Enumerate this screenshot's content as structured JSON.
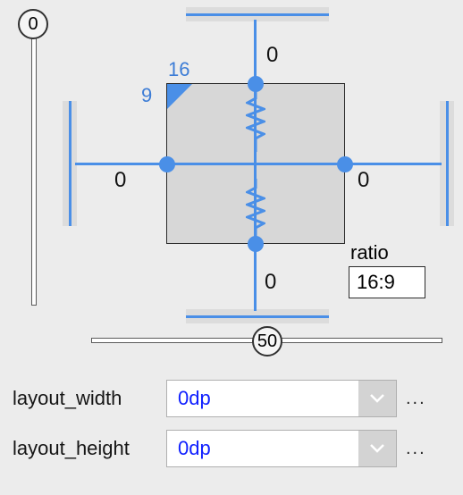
{
  "sliders": {
    "vertical_bias": "0",
    "horizontal_bias": "50"
  },
  "margins": {
    "top": "0",
    "bottom": "0",
    "left": "0",
    "right": "0"
  },
  "aspect": {
    "label": "ratio",
    "width_part": "16",
    "height_part": "9",
    "value": "16:9"
  },
  "props": {
    "layout_width": {
      "label": "layout_width",
      "value": "0dp"
    },
    "layout_height": {
      "label": "layout_height",
      "value": "0dp"
    }
  },
  "more": "..."
}
